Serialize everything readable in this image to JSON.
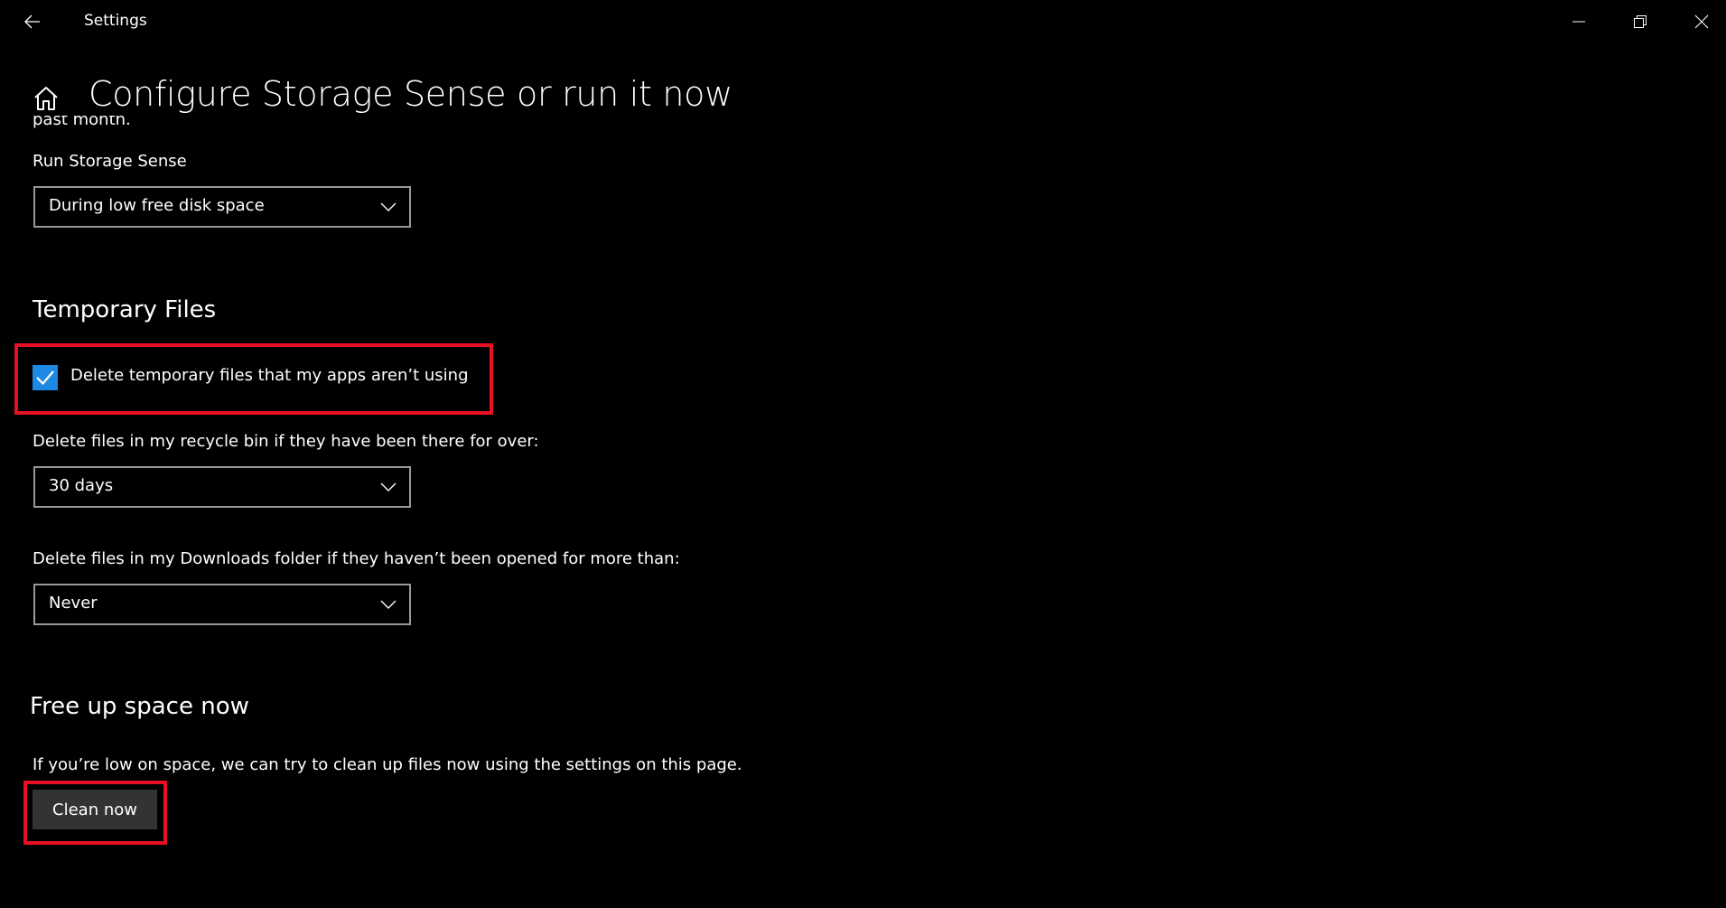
{
  "window": {
    "app_title": "Settings",
    "controls": {
      "back_icon": "arrow-left-icon",
      "minimize_icon": "minimize-icon",
      "restore_icon": "restore-icon",
      "close_icon": "close-icon"
    }
  },
  "header": {
    "home_icon": "home-icon",
    "title": "Configure Storage Sense or run it now"
  },
  "storage_sense": {
    "clipped_prev_text": "past month.",
    "run_label": "Run Storage Sense",
    "run_value": "During low free disk space"
  },
  "temporary_files": {
    "heading": "Temporary Files",
    "delete_temp_checkbox": {
      "label": "Delete temporary files that my apps aren’t using",
      "checked": true,
      "highlighted": true
    },
    "recycle_bin": {
      "label": "Delete files in my recycle bin if they have been there for over:",
      "value": "30 days"
    },
    "downloads": {
      "label": "Delete files in my Downloads folder if they haven’t been opened for more than:",
      "value": "Never"
    }
  },
  "free_up_space": {
    "heading": "Free up space now",
    "description": "If you’re low on space, we can try to clean up files now using the settings on this page.",
    "clean_button": {
      "label": "Clean now",
      "highlighted": true
    }
  },
  "colors": {
    "background": "#000000",
    "text": "#ffffff",
    "accent": "#1e88e5",
    "highlight": "#e81123",
    "button_bg": "#333333",
    "combo_border": "#999999"
  }
}
